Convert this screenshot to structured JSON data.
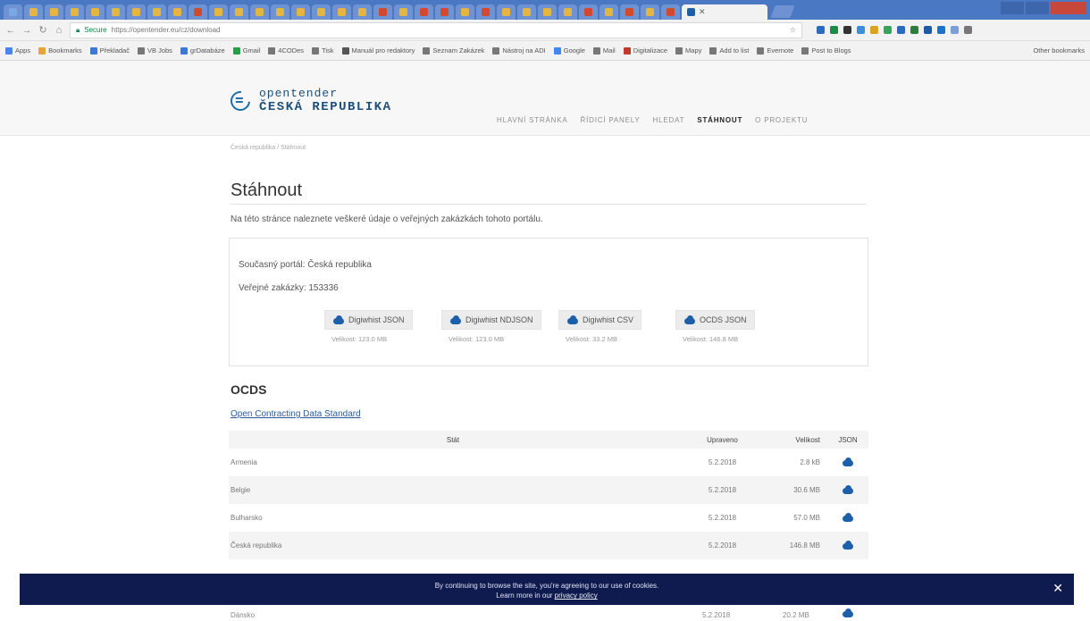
{
  "browser": {
    "url": "https://opentender.eu/cz/download",
    "secure_label": "Secure",
    "bookmarks": [
      "Apps",
      "Bookmarks",
      "Překladač",
      "VB Jobs",
      "grDatabáze",
      "Gmail",
      "4CODes",
      "Tisk",
      "Manuál pro redaktory",
      "Seznam Zakázek",
      "Nástroj na ADI",
      "Google",
      "Mail",
      "Digitalizace",
      "Mapy",
      "Add to list",
      "Evernote",
      "Post to Blogs"
    ],
    "other_bookmarks": "Other bookmarks",
    "tab_favicon_colors": [
      "#7aa7e6",
      "#e3b641",
      "#e3b641",
      "#e3b641",
      "#e3b641",
      "#e3b641",
      "#e3b641",
      "#e3b641",
      "#e3b641",
      "#d2492e",
      "#e3b641",
      "#e3b641",
      "#e3b641",
      "#e3b641",
      "#e3b641",
      "#e3b641",
      "#e3b641",
      "#e3b641",
      "#d2492e",
      "#e3b641",
      "#d2492e",
      "#d2492e",
      "#e3b641",
      "#d2492e",
      "#e3b641",
      "#e3b641",
      "#e3b641",
      "#e3b641",
      "#d2492e",
      "#e3b641",
      "#d2492e",
      "#e3b641",
      "#d2492e"
    ]
  },
  "site": {
    "logo_line1": "opentender",
    "logo_line2": "ČESKÁ REPUBLIKA",
    "nav": [
      "HLAVNÍ STRÁNKA",
      "ŘÍDICÍ PANELY",
      "HLEDAT",
      "STÁHNOUT",
      "O PROJEKTU"
    ],
    "nav_active_index": 3
  },
  "breadcrumb": "Česká republika / Stáhnout",
  "page_title": "Stáhnout",
  "intro": "Na této stránce naleznete veškeré údaje o veřejných zakázkách tohoto portálu.",
  "portal": {
    "current_label": "Současný portál: Česká republika",
    "tenders_label": "Veřejné zakázky: 153336",
    "downloads": [
      {
        "label": "Digiwhist JSON",
        "size": "Velikost: 123.0 MB"
      },
      {
        "label": "Digiwhist NDJSON",
        "size": "Velikost: 123.0 MB"
      },
      {
        "label": "Digiwhist CSV",
        "size": "Velikost: 33.2 MB"
      },
      {
        "label": "OCDS JSON",
        "size": "Velikost: 146.8 MB"
      }
    ]
  },
  "ocds": {
    "heading": "OCDS",
    "link": "Open Contracting Data Standard",
    "columns": [
      "Stát",
      "Upraveno",
      "Velikost",
      "JSON"
    ],
    "rows": [
      {
        "country": "Armenia",
        "updated": "5.2.2018",
        "size": "2.8 kB"
      },
      {
        "country": "Belgie",
        "updated": "5.2.2018",
        "size": "30.6 MB"
      },
      {
        "country": "Bulharsko",
        "updated": "5.2.2018",
        "size": "57.0 MB"
      },
      {
        "country": "Česká republika",
        "updated": "5.2.2018",
        "size": "146.8 MB"
      }
    ],
    "partial_row": {
      "country": "Dánsko",
      "updated": "5.2.2018",
      "size": "20.2 MB"
    }
  },
  "cookie": {
    "line1": "By continuing to browse the site, you're agreeing to our use of cookies.",
    "line2_prefix": "Learn more in our ",
    "link": "privacy policy",
    "close": "✕"
  },
  "colors": {
    "accent": "#1d5fa8",
    "banner": "#0f1a4f"
  }
}
